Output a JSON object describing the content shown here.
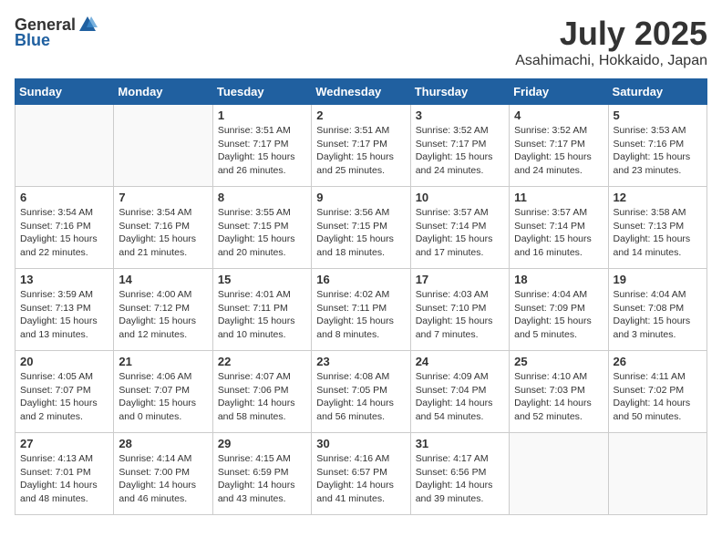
{
  "header": {
    "logo_general": "General",
    "logo_blue": "Blue",
    "month_title": "July 2025",
    "location": "Asahimachi, Hokkaido, Japan"
  },
  "days_of_week": [
    "Sunday",
    "Monday",
    "Tuesday",
    "Wednesday",
    "Thursday",
    "Friday",
    "Saturday"
  ],
  "weeks": [
    [
      {
        "day": "",
        "info": ""
      },
      {
        "day": "",
        "info": ""
      },
      {
        "day": "1",
        "info": "Sunrise: 3:51 AM\nSunset: 7:17 PM\nDaylight: 15 hours\nand 26 minutes."
      },
      {
        "day": "2",
        "info": "Sunrise: 3:51 AM\nSunset: 7:17 PM\nDaylight: 15 hours\nand 25 minutes."
      },
      {
        "day": "3",
        "info": "Sunrise: 3:52 AM\nSunset: 7:17 PM\nDaylight: 15 hours\nand 24 minutes."
      },
      {
        "day": "4",
        "info": "Sunrise: 3:52 AM\nSunset: 7:17 PM\nDaylight: 15 hours\nand 24 minutes."
      },
      {
        "day": "5",
        "info": "Sunrise: 3:53 AM\nSunset: 7:16 PM\nDaylight: 15 hours\nand 23 minutes."
      }
    ],
    [
      {
        "day": "6",
        "info": "Sunrise: 3:54 AM\nSunset: 7:16 PM\nDaylight: 15 hours\nand 22 minutes."
      },
      {
        "day": "7",
        "info": "Sunrise: 3:54 AM\nSunset: 7:16 PM\nDaylight: 15 hours\nand 21 minutes."
      },
      {
        "day": "8",
        "info": "Sunrise: 3:55 AM\nSunset: 7:15 PM\nDaylight: 15 hours\nand 20 minutes."
      },
      {
        "day": "9",
        "info": "Sunrise: 3:56 AM\nSunset: 7:15 PM\nDaylight: 15 hours\nand 18 minutes."
      },
      {
        "day": "10",
        "info": "Sunrise: 3:57 AM\nSunset: 7:14 PM\nDaylight: 15 hours\nand 17 minutes."
      },
      {
        "day": "11",
        "info": "Sunrise: 3:57 AM\nSunset: 7:14 PM\nDaylight: 15 hours\nand 16 minutes."
      },
      {
        "day": "12",
        "info": "Sunrise: 3:58 AM\nSunset: 7:13 PM\nDaylight: 15 hours\nand 14 minutes."
      }
    ],
    [
      {
        "day": "13",
        "info": "Sunrise: 3:59 AM\nSunset: 7:13 PM\nDaylight: 15 hours\nand 13 minutes."
      },
      {
        "day": "14",
        "info": "Sunrise: 4:00 AM\nSunset: 7:12 PM\nDaylight: 15 hours\nand 12 minutes."
      },
      {
        "day": "15",
        "info": "Sunrise: 4:01 AM\nSunset: 7:11 PM\nDaylight: 15 hours\nand 10 minutes."
      },
      {
        "day": "16",
        "info": "Sunrise: 4:02 AM\nSunset: 7:11 PM\nDaylight: 15 hours\nand 8 minutes."
      },
      {
        "day": "17",
        "info": "Sunrise: 4:03 AM\nSunset: 7:10 PM\nDaylight: 15 hours\nand 7 minutes."
      },
      {
        "day": "18",
        "info": "Sunrise: 4:04 AM\nSunset: 7:09 PM\nDaylight: 15 hours\nand 5 minutes."
      },
      {
        "day": "19",
        "info": "Sunrise: 4:04 AM\nSunset: 7:08 PM\nDaylight: 15 hours\nand 3 minutes."
      }
    ],
    [
      {
        "day": "20",
        "info": "Sunrise: 4:05 AM\nSunset: 7:07 PM\nDaylight: 15 hours\nand 2 minutes."
      },
      {
        "day": "21",
        "info": "Sunrise: 4:06 AM\nSunset: 7:07 PM\nDaylight: 15 hours\nand 0 minutes."
      },
      {
        "day": "22",
        "info": "Sunrise: 4:07 AM\nSunset: 7:06 PM\nDaylight: 14 hours\nand 58 minutes."
      },
      {
        "day": "23",
        "info": "Sunrise: 4:08 AM\nSunset: 7:05 PM\nDaylight: 14 hours\nand 56 minutes."
      },
      {
        "day": "24",
        "info": "Sunrise: 4:09 AM\nSunset: 7:04 PM\nDaylight: 14 hours\nand 54 minutes."
      },
      {
        "day": "25",
        "info": "Sunrise: 4:10 AM\nSunset: 7:03 PM\nDaylight: 14 hours\nand 52 minutes."
      },
      {
        "day": "26",
        "info": "Sunrise: 4:11 AM\nSunset: 7:02 PM\nDaylight: 14 hours\nand 50 minutes."
      }
    ],
    [
      {
        "day": "27",
        "info": "Sunrise: 4:13 AM\nSunset: 7:01 PM\nDaylight: 14 hours\nand 48 minutes."
      },
      {
        "day": "28",
        "info": "Sunrise: 4:14 AM\nSunset: 7:00 PM\nDaylight: 14 hours\nand 46 minutes."
      },
      {
        "day": "29",
        "info": "Sunrise: 4:15 AM\nSunset: 6:59 PM\nDaylight: 14 hours\nand 43 minutes."
      },
      {
        "day": "30",
        "info": "Sunrise: 4:16 AM\nSunset: 6:57 PM\nDaylight: 14 hours\nand 41 minutes."
      },
      {
        "day": "31",
        "info": "Sunrise: 4:17 AM\nSunset: 6:56 PM\nDaylight: 14 hours\nand 39 minutes."
      },
      {
        "day": "",
        "info": ""
      },
      {
        "day": "",
        "info": ""
      }
    ]
  ]
}
